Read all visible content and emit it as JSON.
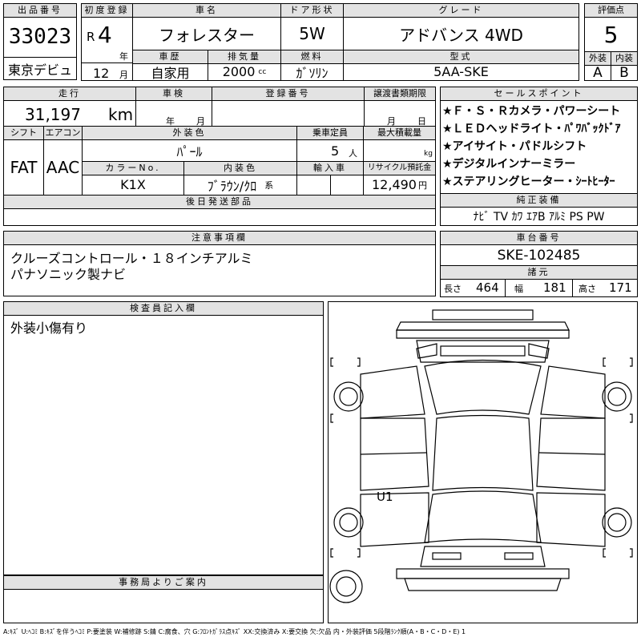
{
  "lot": {
    "label": "出品番号",
    "value": "33023",
    "debut": "東京デビュ"
  },
  "reg": {
    "label": "初度登録",
    "era": "R",
    "year": "4",
    "year_unit": "年",
    "month": "12",
    "month_unit": "月"
  },
  "car": {
    "name_label": "車名",
    "name": "フォレスター",
    "history_label": "車歴",
    "history": "自家用",
    "displacement_label": "排気量",
    "displacement": "2000",
    "displacement_unit": "cc"
  },
  "door": {
    "label": "ドア形状",
    "value": "5W",
    "fuel_label": "燃料",
    "fuel": "ｶﾞｿﾘﾝ"
  },
  "grade": {
    "label": "グレード",
    "value": "アドバンス 4WD",
    "model_label": "型式",
    "model": "5AA-SKE"
  },
  "score": {
    "label": "評価点",
    "value": "5",
    "ext_label": "外装",
    "int_label": "内装",
    "ext": "A",
    "int": "B"
  },
  "mileage": {
    "label": "走行",
    "value": "31,197",
    "unit": "km"
  },
  "inspection": {
    "label": "車検",
    "year_unit": "年",
    "month_unit": "月"
  },
  "plate": {
    "label": "登録番号"
  },
  "transfer": {
    "label": "譲渡書類期限",
    "month_unit": "月",
    "day_unit": "日"
  },
  "shift": {
    "label": "シフト",
    "value": "FAT"
  },
  "ac": {
    "label": "エアコン",
    "value": "AAC"
  },
  "ext_color": {
    "label": "外装色",
    "value": "ﾊﾟｰﾙ"
  },
  "capacity": {
    "label": "乗車定員",
    "value": "5",
    "unit": "人"
  },
  "load": {
    "label": "最大積載量",
    "unit": "kg"
  },
  "color_no": {
    "label": "カラーNo.",
    "value": "K1X"
  },
  "int_color": {
    "label": "内装色",
    "value": "ﾌﾞﾗｳﾝ/ｸﾛ",
    "suffix": "系"
  },
  "import": {
    "label": "輸入車"
  },
  "recycle": {
    "label": "リサイクル預託金",
    "value": "12,490",
    "unit": "円"
  },
  "later_parts": {
    "label": "後日発送部品"
  },
  "sales_points": {
    "label": "セールスポイント",
    "items": [
      "★Ｆ・Ｓ・Ｒカメラ・パワーシート",
      "★ＬＥＤヘッドライト・ﾊﾟﾜﾊﾞｯｸﾄﾞｱ",
      "★アイサイト・パドルシフト",
      "★デジタルインナーミラー",
      "★ステアリングヒーター・ｼｰﾄﾋｰﾀｰ"
    ]
  },
  "equipment": {
    "label": "純正装備",
    "value": "ﾅﾋﾞ TV ｶﾜ ｴｱB ｱﾙﾐ PS PW"
  },
  "notes": {
    "label": "注意事項欄",
    "lines": [
      "クルーズコントロール・１８インチアルミ",
      "パナソニック製ナビ"
    ]
  },
  "chassis": {
    "label": "車台番号",
    "value": "SKE-102485"
  },
  "dims": {
    "label": "諸元",
    "length_label": "長さ",
    "length": "464",
    "width_label": "幅",
    "width": "181",
    "height_label": "高さ",
    "height": "171"
  },
  "inspector": {
    "label": "検査員記入欄",
    "text": "外装小傷有り"
  },
  "office": {
    "label": "事務局よりご案内"
  },
  "diagram": {
    "mark": "U1"
  },
  "legend": "A:ｷｽﾞ U:ﾍｺﾐ B:ｷｽﾞを伴うﾍｺﾐ P:要塗装 W:補修跡 S:錆 C:腐食、穴 G:ﾌﾛﾝﾄｶﾞﾗｽ点ｷｽﾞ XX:交換済み X:要交換 欠:欠品 内・外装評価 5段階ﾗﾝｸ順(A・B・C・D・E) 1"
}
